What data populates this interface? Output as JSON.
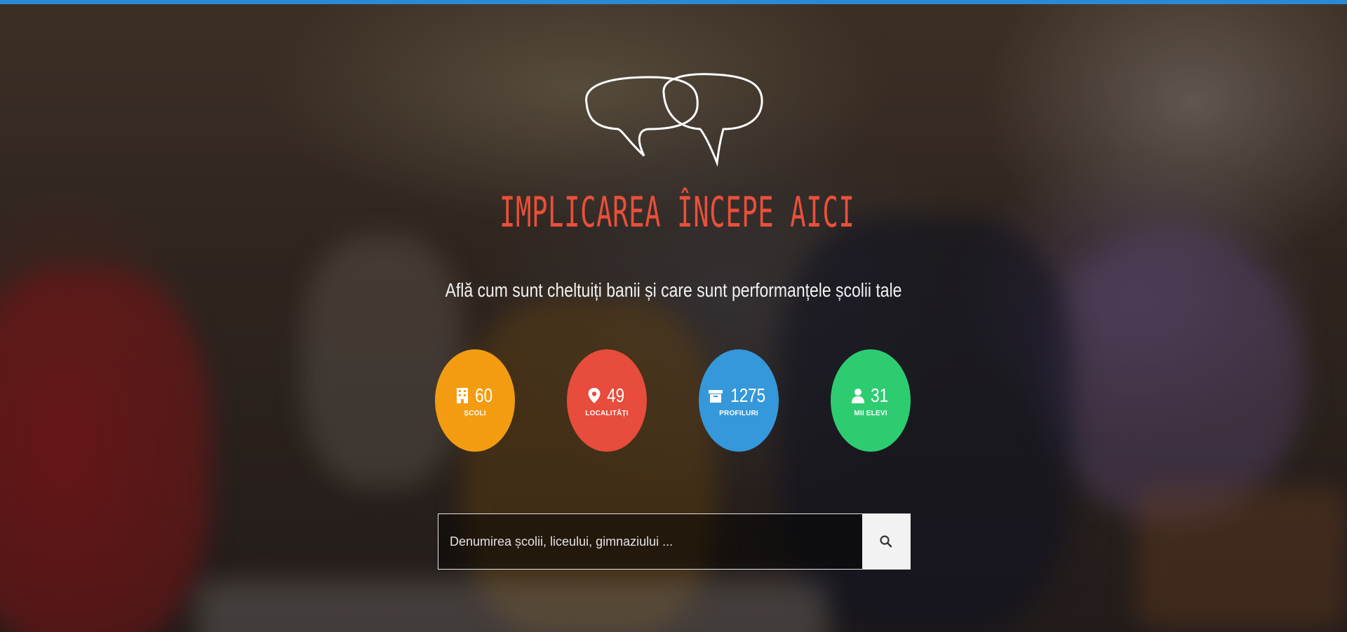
{
  "hero": {
    "headline": "IMPLICAREA ÎNCEPE AICI",
    "subtitle": "Află cum sunt cheltuiți banii și care sunt performanțele școlii tale"
  },
  "stats": [
    {
      "value": "60",
      "label": "ȘCOLI",
      "icon": "building-icon",
      "color": "#f39c12"
    },
    {
      "value": "49",
      "label": "LOCALITĂȚI",
      "icon": "map-marker-icon",
      "color": "#e74c3c"
    },
    {
      "value": "1275",
      "label": "PROFILURI",
      "icon": "archive-icon",
      "color": "#3498db"
    },
    {
      "value": "31",
      "label": "MII ELEVI",
      "icon": "user-icon",
      "color": "#2ecc71"
    }
  ],
  "search": {
    "placeholder": "Denumirea școlii, liceului, gimnaziului ...",
    "button_icon": "search-icon"
  },
  "colors": {
    "topbar": "#2b8ad6",
    "headline": "#e8503a"
  }
}
